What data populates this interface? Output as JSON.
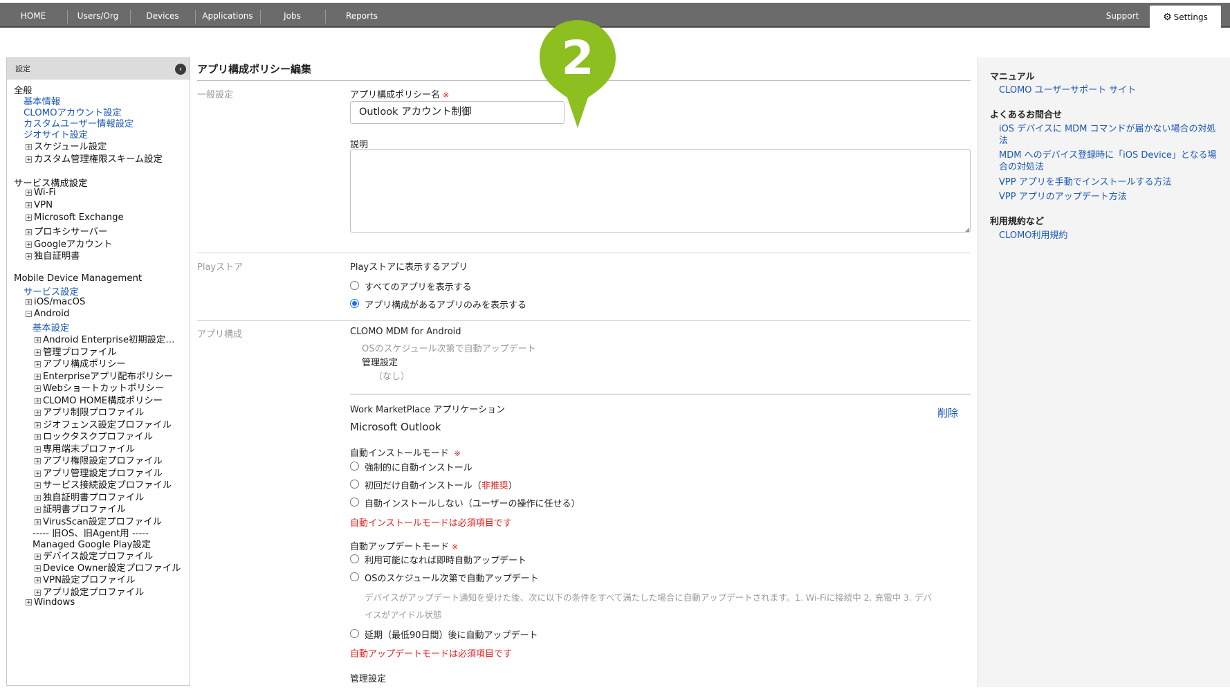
{
  "topnav": {
    "items": [
      "HOME",
      "Users/Org",
      "Devices",
      "Applications",
      "Jobs",
      "Reports"
    ],
    "support": "Support",
    "settings": "Settings"
  },
  "sidebar": {
    "header": "設定",
    "items": [
      {
        "label": "全般",
        "type": "section"
      },
      {
        "label": "基本情報",
        "type": "link"
      },
      {
        "label": "CLOMOアカウント設定",
        "type": "link"
      },
      {
        "label": "カスタムユーザー情報設定",
        "type": "link"
      },
      {
        "label": "ジオサイト設定",
        "type": "link"
      },
      {
        "label": "スケジュール設定",
        "type": "node"
      },
      {
        "label": "カスタム管理権限スキーム設定",
        "type": "node"
      },
      {
        "label": "サービス構成設定",
        "type": "section"
      },
      {
        "label": "Wi-Fi",
        "type": "node"
      },
      {
        "label": "VPN",
        "type": "node"
      },
      {
        "label": "Microsoft Exchange",
        "type": "node"
      },
      {
        "label": "プロキシサーバー",
        "type": "node"
      },
      {
        "label": "Googleアカウント",
        "type": "node"
      },
      {
        "label": "独自証明書",
        "type": "node"
      },
      {
        "label": "Mobile Device Management",
        "type": "section"
      },
      {
        "label": "サービス設定",
        "type": "link"
      },
      {
        "label": "iOS/macOS",
        "type": "node"
      },
      {
        "label": "Android",
        "type": "node-open"
      },
      {
        "label": "基本設定",
        "type": "link2"
      },
      {
        "label": "Android Enterprise初期設定…",
        "type": "node2"
      },
      {
        "label": "管理プロファイル",
        "type": "node2"
      },
      {
        "label": "アプリ構成ポリシー",
        "type": "node2"
      },
      {
        "label": "Enterpriseアプリ配布ポリシー",
        "type": "node2"
      },
      {
        "label": "Webショートカットポリシー",
        "type": "node2"
      },
      {
        "label": "CLOMO HOME構成ポリシー",
        "type": "node2"
      },
      {
        "label": "アプリ制限プロファイル",
        "type": "node2"
      },
      {
        "label": "ジオフェンス設定プロファイル",
        "type": "node2"
      },
      {
        "label": "ロックタスクプロファイル",
        "type": "node2"
      },
      {
        "label": "専用端末プロファイル",
        "type": "node2"
      },
      {
        "label": "アプリ権限設定プロファイル",
        "type": "node2"
      },
      {
        "label": "アプリ管理設定プロファイル",
        "type": "node2"
      },
      {
        "label": "サービス接続設定プロファイル",
        "type": "node2"
      },
      {
        "label": "独自証明書プロファイル",
        "type": "node2"
      },
      {
        "label": "証明書プロファイル",
        "type": "node2"
      },
      {
        "label": "VirusScan設定プロファイル",
        "type": "node2"
      },
      {
        "label": "----- 旧OS、旧Agent用 -----",
        "type": "text2"
      },
      {
        "label": "Managed Google Play設定",
        "type": "text2"
      },
      {
        "label": "デバイス設定プロファイル",
        "type": "node2"
      },
      {
        "label": "Device Owner設定プロファイル",
        "type": "node2"
      },
      {
        "label": "VPN設定プロファイル",
        "type": "node2"
      },
      {
        "label": "アプリ設定プロファイル",
        "type": "node2"
      },
      {
        "label": "Windows",
        "type": "node"
      }
    ]
  },
  "main": {
    "title": "アプリ構成ポリシー編集",
    "general": {
      "section": "一般設定",
      "name_label": "アプリ構成ポリシー名",
      "required_mark": "※",
      "name_value": "Outlook アカウント制御",
      "desc_label": "説明",
      "desc_value": ""
    },
    "playstore": {
      "section": "Playストア",
      "label": "Playストアに表示するアプリ",
      "options": [
        "すべてのアプリを表示する",
        "アプリ構成があるアプリのみを表示する"
      ],
      "selected": 1
    },
    "appconfig": {
      "section": "アプリ構成",
      "app1_name": "CLOMO MDM for Android",
      "app1_update": "OSのスケジュール次第で自動アップデート",
      "app1_mgmt_label": "管理設定",
      "app1_mgmt_value": "（なし）",
      "wmp_label": "Work MarketPlace アプリケーション",
      "delete_label": "削除",
      "app2_name": "Microsoft Outlook",
      "install_mode_label": "自動インストールモード",
      "install_options": [
        "強制的に自動インストール",
        "初回だけ自動インストール（",
        "非推奨",
        "）",
        "自動インストールしない（ユーザーの操作に任せる）"
      ],
      "install_error": "自動インストールモードは必須項目です",
      "update_mode_label": "自動アップデートモード",
      "update_options": [
        "利用可能になれば即時自動アップデート",
        "OSのスケジュール次第で自動アップデート",
        "延期（最低90日間）後に自動アップデート"
      ],
      "update_note_1": "デバイスがアップデート通知を受けた後、次に以下の条件をすべて満たした場合に自動アップデートされます。1. Wi-Fiに接続中 2. 充電中 3. デバ",
      "update_note_2": "イスがアイドル状態",
      "update_error": "自動アップデートモードは必須項目です",
      "mgmt_label": "管理設定"
    }
  },
  "right": {
    "manual_heading": "マニュアル",
    "manual_link": "CLOMO ユーザーサポート サイト",
    "faq_heading": "よくあるお問合せ",
    "faq_links": [
      "iOS デバイスに MDM コマンドが届かない場合の対処法",
      "MDM へのデバイス登録時に「iOS Device」となる場合の対処法",
      "VPP アプリを手動でインストールする方法",
      "VPP アプリのアップデート方法"
    ],
    "terms_heading": "利用規約など",
    "terms_link": "CLOMO利用規約"
  },
  "marker": {
    "number": "2",
    "color": "#8cbf1f"
  }
}
